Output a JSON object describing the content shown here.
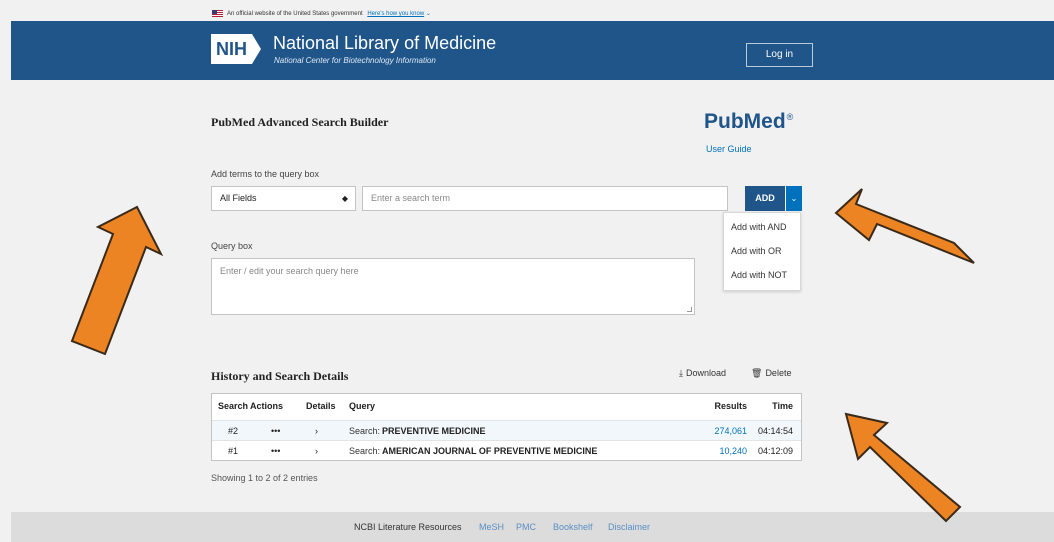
{
  "gov_banner": {
    "official": "An official website of the United States government",
    "how": "Here's how you know"
  },
  "header": {
    "nih": "NIH",
    "title": "National Library of Medicine",
    "subtitle": "National Center for Biotechnology Information",
    "login": "Log in"
  },
  "page": {
    "title": "PubMed Advanced Search Builder",
    "logo": "PubMed",
    "logo_mark": "®",
    "user_guide": "User Guide"
  },
  "builder": {
    "terms_label": "Add terms to the query box",
    "field_value": "All Fields",
    "term_placeholder": "Enter a search term",
    "add_label": "ADD",
    "menu": [
      "Add with AND",
      "Add with OR",
      "Add with NOT"
    ]
  },
  "query": {
    "label": "Query box",
    "placeholder": "Enter / edit your search query here"
  },
  "history": {
    "title": "History and Search Details",
    "download": "Download",
    "delete": "Delete",
    "columns": {
      "search": "Search",
      "actions": "Actions",
      "details": "Details",
      "query": "Query",
      "results": "Results",
      "time": "Time"
    },
    "rows": [
      {
        "search": "#2",
        "actions": "•••",
        "details": "›",
        "prefix": "Search:",
        "term": "PREVENTIVE MEDICINE",
        "results": "274,061",
        "time": "04:14:54"
      },
      {
        "search": "#1",
        "actions": "•••",
        "details": "›",
        "prefix": "Search:",
        "term": "AMERICAN JOURNAL OF PREVENTIVE MEDICINE",
        "results": "10,240",
        "time": "04:12:09"
      }
    ],
    "showing": "Showing 1 to 2 of 2 entries"
  },
  "footer": {
    "title": "NCBI Literature Resources",
    "links": [
      "MeSH",
      "PMC",
      "Bookshelf",
      "Disclaimer"
    ]
  },
  "colors": {
    "header": "#20558a",
    "accent": "#0071bc",
    "arrow": "#ed8424",
    "arrow_outline": "#3a2a1a"
  },
  "icons": {
    "select_caret": "updown-caret-icon",
    "dropdown": "chevron-down-icon",
    "download": "download-icon",
    "delete": "trash-icon"
  }
}
